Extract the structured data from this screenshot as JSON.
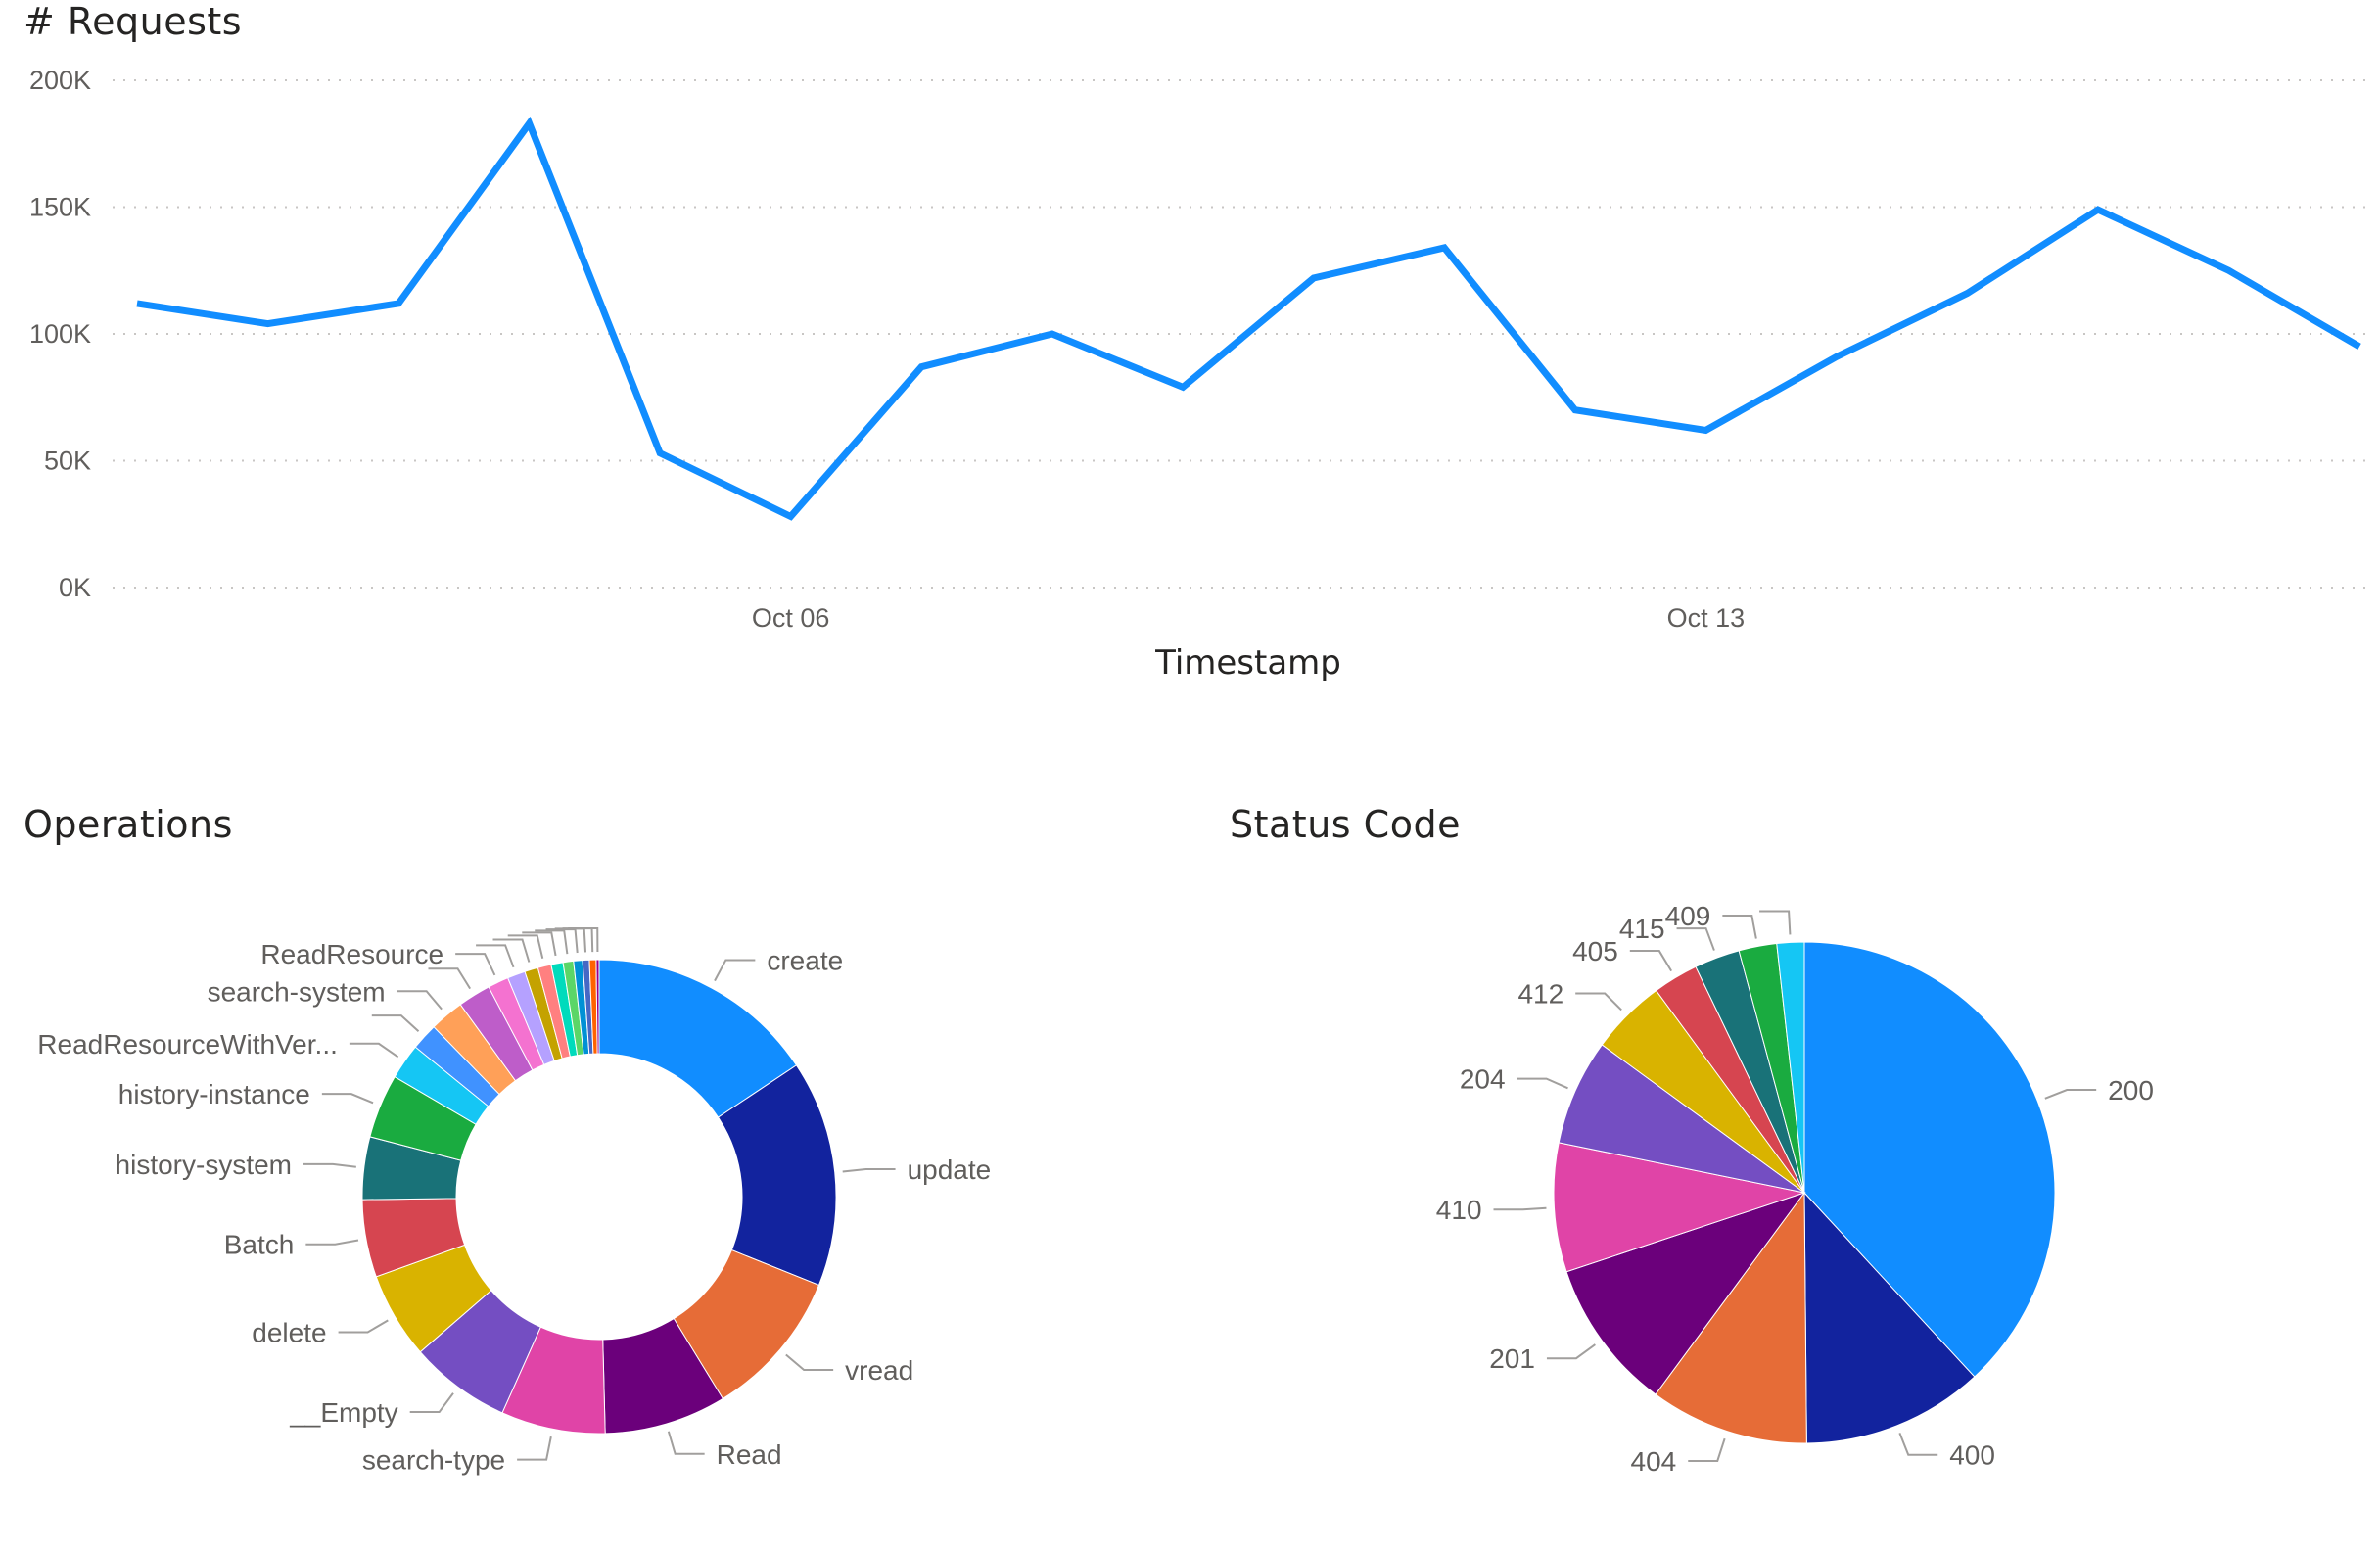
{
  "chart_data": [
    {
      "type": "line",
      "title": "# Requests",
      "xlabel": "Timestamp",
      "ylabel": "",
      "ylim": [
        0,
        200000
      ],
      "y_ticks": [
        {
          "value": 0,
          "label": "0K"
        },
        {
          "value": 50000,
          "label": "50K"
        },
        {
          "value": 100000,
          "label": "100K"
        },
        {
          "value": 150000,
          "label": "150K"
        },
        {
          "value": 200000,
          "label": "200K"
        }
      ],
      "x_ticks": [
        {
          "x": "2020-10-06",
          "label": "Oct 06"
        },
        {
          "x": "2020-10-13",
          "label": "Oct 13"
        }
      ],
      "x": [
        "2020-10-01",
        "2020-10-02",
        "2020-10-03",
        "2020-10-04",
        "2020-10-05",
        "2020-10-06",
        "2020-10-07",
        "2020-10-08",
        "2020-10-09",
        "2020-10-10",
        "2020-10-11",
        "2020-10-12",
        "2020-10-13",
        "2020-10-14",
        "2020-10-15",
        "2020-10-16",
        "2020-10-17",
        "2020-10-18"
      ],
      "series": [
        {
          "color": "#118DFF",
          "values": [
            112000,
            104000,
            112000,
            183000,
            53000,
            28000,
            87000,
            100000,
            79000,
            122000,
            134000,
            70000,
            62000,
            91000,
            116000,
            149000,
            125000,
            95000
          ]
        }
      ],
      "grid": true,
      "legend": "none"
    },
    {
      "type": "donut",
      "title": "Operations",
      "slices": [
        {
          "label": "create",
          "value": 15.4,
          "color": "#118DFF"
        },
        {
          "label": "update",
          "value": 15.2,
          "color": "#12239E"
        },
        {
          "label": "vread",
          "value": 10.0,
          "color": "#E66C37"
        },
        {
          "label": "Read",
          "value": 8.2,
          "color": "#6B007B"
        },
        {
          "label": "search-type",
          "value": 7.0,
          "color": "#E044A7"
        },
        {
          "label": "__Empty",
          "value": 6.8,
          "color": "#744EC2"
        },
        {
          "label": "delete",
          "value": 5.8,
          "color": "#D9B300"
        },
        {
          "label": "Batch",
          "value": 5.2,
          "color": "#D64550"
        },
        {
          "label": "history-system",
          "value": 4.2,
          "color": "#197278"
        },
        {
          "label": "history-instance",
          "value": 4.3,
          "color": "#1AAB40"
        },
        {
          "label": "ReadResourceWithVer...",
          "value": 2.4,
          "color": "#15C6F4"
        },
        {
          "label": "",
          "value": 1.8,
          "color": "#4092FF"
        },
        {
          "label": "search-system",
          "value": 2.3,
          "color": "#FFA058"
        },
        {
          "label": "",
          "value": 2.2,
          "color": "#BE5DC9"
        },
        {
          "label": "ReadResource",
          "value": 1.4,
          "color": "#F472D0"
        },
        {
          "label": "",
          "value": 1.2,
          "color": "#B5A1FF"
        },
        {
          "label": "",
          "value": 0.9,
          "color": "#C4A200"
        },
        {
          "label": "",
          "value": 0.9,
          "color": "#FF8080"
        },
        {
          "label": "",
          "value": 0.8,
          "color": "#00DBBC"
        },
        {
          "label": "",
          "value": 0.7,
          "color": "#5BD667"
        },
        {
          "label": "",
          "value": 0.6,
          "color": "#0091D5"
        },
        {
          "label": "",
          "value": 0.45,
          "color": "#4668C5"
        },
        {
          "label": "",
          "value": 0.45,
          "color": "#FF6300"
        },
        {
          "label": "",
          "value": 0.2,
          "color": "#99008A"
        }
      ],
      "legend": "none"
    },
    {
      "type": "pie",
      "title": "Status Code",
      "slices": [
        {
          "label": "200",
          "value": 39.0,
          "color": "#118DFF"
        },
        {
          "label": "400",
          "value": 12.0,
          "color": "#12239E"
        },
        {
          "label": "404",
          "value": 10.5,
          "color": "#E66C37"
        },
        {
          "label": "201",
          "value": 10.0,
          "color": "#6B007B"
        },
        {
          "label": "410",
          "value": 8.5,
          "color": "#E044A7"
        },
        {
          "label": "204",
          "value": 7.0,
          "color": "#744EC2"
        },
        {
          "label": "412",
          "value": 5.0,
          "color": "#D9B300"
        },
        {
          "label": "405",
          "value": 3.0,
          "color": "#D64550"
        },
        {
          "label": "415",
          "value": 3.0,
          "color": "#197278"
        },
        {
          "label": "409",
          "value": 2.5,
          "color": "#1AAB40"
        },
        {
          "label": "",
          "value": 1.8,
          "color": "#15C6F4"
        }
      ],
      "legend": "none"
    }
  ]
}
